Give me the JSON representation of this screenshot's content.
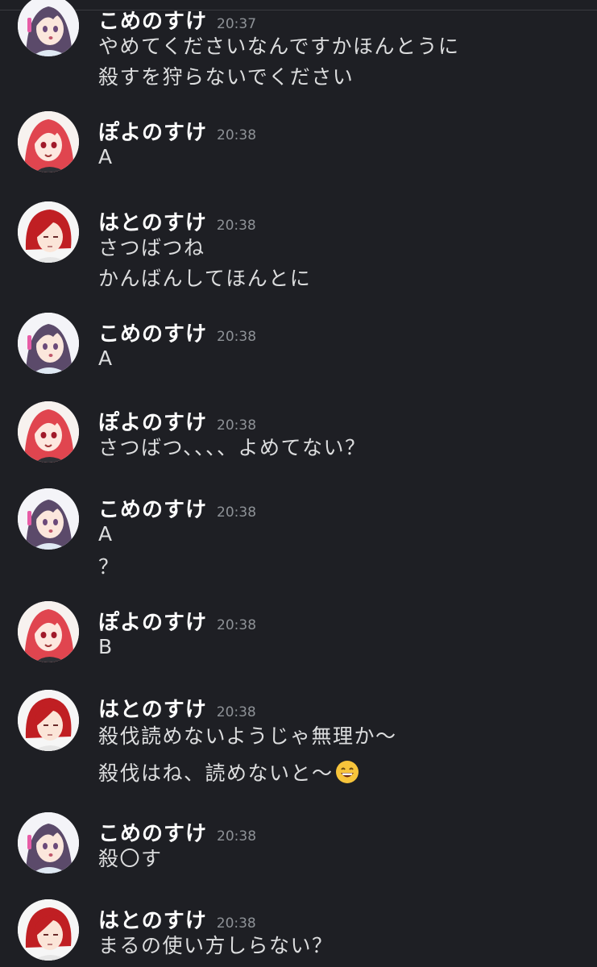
{
  "messages": [
    {
      "author": "こめのすけ",
      "time": "20:37",
      "avatar": "kome-avatar",
      "lines": [
        "やめてくださいなんですかほんとうに",
        "殺すを狩らないでください"
      ]
    },
    {
      "author": "ぽよのすけ",
      "time": "20:38",
      "avatar": "poyo-avatar",
      "lines": [
        "A"
      ]
    },
    {
      "author": "はとのすけ",
      "time": "20:38",
      "avatar": "hato-avatar",
      "lines": [
        "さつばつね",
        "かんばんしてほんとに"
      ]
    },
    {
      "author": "こめのすけ",
      "time": "20:38",
      "avatar": "kome-avatar",
      "lines": [
        "A"
      ]
    },
    {
      "author": "ぽよのすけ",
      "time": "20:38",
      "avatar": "poyo-avatar",
      "lines": [
        "さつばつ、、、、よめてない？"
      ]
    },
    {
      "author": "こめのすけ",
      "time": "20:38",
      "avatar": "kome-avatar",
      "lines": [
        "A",
        "？"
      ]
    },
    {
      "author": "ぽよのすけ",
      "time": "20:38",
      "avatar": "poyo-avatar",
      "lines": [
        "B"
      ]
    },
    {
      "author": "はとのすけ",
      "time": "20:38",
      "avatar": "hato-avatar",
      "lines": [
        "殺伐読めないようじゃ無理か〜",
        "殺伐はね、読めないと〜"
      ],
      "emoji": "grinning-face-emoji"
    },
    {
      "author": "こめのすけ",
      "time": "20:38",
      "avatar": "kome-avatar",
      "lines": [
        "殺〇す"
      ]
    },
    {
      "author": "はとのすけ",
      "time": "20:38",
      "avatar": "hato-avatar",
      "lines": [
        "まるの使い方しらない？"
      ]
    }
  ]
}
